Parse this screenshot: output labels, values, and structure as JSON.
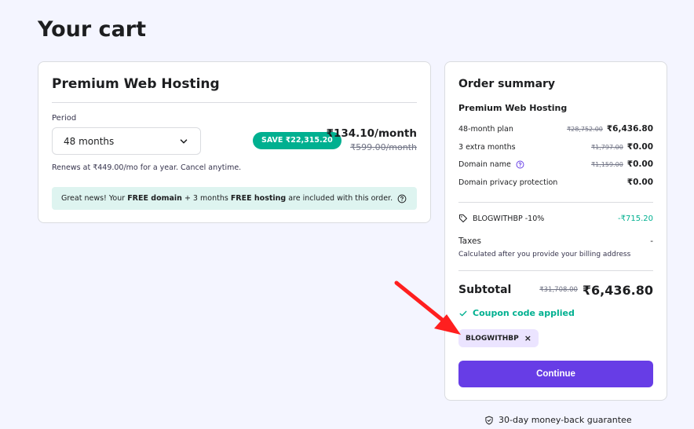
{
  "page": {
    "title": "Your cart"
  },
  "cart": {
    "plan_title": "Premium Web Hosting",
    "period_label": "Period",
    "period_value": "48 months",
    "save_badge": "SAVE ₹22,315.20",
    "price": "₹134.10/month",
    "old_price": "₹599.00/month",
    "renew_text": "Renews at ₹449.00/mo for a year. Cancel anytime.",
    "promo": {
      "t1": "Great news! Your ",
      "b1": "FREE domain",
      "t2": " + 3 months ",
      "b2": "FREE hosting",
      "t3": " are included with this order."
    }
  },
  "summary": {
    "title": "Order summary",
    "plan": "Premium Web Hosting",
    "lines": [
      {
        "label": "48-month plan",
        "old": "₹28,752.00",
        "value": "₹6,436.80"
      },
      {
        "label": "3 extra months",
        "old": "₹1,797.00",
        "value": "₹0.00"
      },
      {
        "label": "Domain name",
        "old": "₹1,159.00",
        "value": "₹0.00"
      },
      {
        "label": "Domain privacy protection",
        "value": "₹0.00"
      }
    ],
    "coupon_line": {
      "label": "BLOGWITHBP -10%",
      "value": "-₹715.20"
    },
    "taxes": {
      "label": "Taxes",
      "value": "-",
      "note": "Calculated after you provide your billing address"
    },
    "subtotal": {
      "label": "Subtotal",
      "old": "₹31,708.00",
      "value": "₹6,436.80"
    },
    "coupon_applied": "Coupon code applied",
    "coupon_chip": "BLOGWITHBP",
    "continue_label": "Continue"
  },
  "guarantee": "30-day money-back guarantee",
  "colors": {
    "accent": "#673de6",
    "success": "#00b090",
    "annotation": "#ff1f1f"
  },
  "icons": [
    "chevron-down-icon",
    "help-circle-icon",
    "tag-icon",
    "check-icon",
    "close-icon",
    "shield-check-icon",
    "annotation-arrow"
  ]
}
